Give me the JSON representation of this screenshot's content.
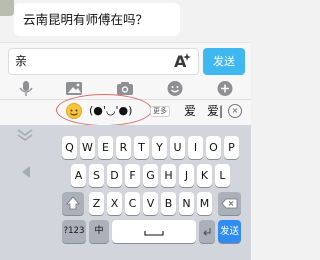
{
  "chat": {
    "message": "云南昆明有师傅在吗？"
  },
  "input": {
    "value": "亲",
    "font_label": "A",
    "send_label": "发送"
  },
  "tools": [
    "mic-icon",
    "image-icon",
    "camera-icon",
    "emoji-face-icon",
    "plus-icon"
  ],
  "candidates": {
    "emoji": "smiley-emoji",
    "kaomoji": "(●'◡'●)",
    "more_label": "更多",
    "word1": "爱",
    "word2": "爱|",
    "clear_icon": "clear-icon"
  },
  "keyboard": {
    "row1": [
      "Q",
      "W",
      "E",
      "R",
      "T",
      "Y",
      "U",
      "I",
      "O",
      "P"
    ],
    "row2": [
      "A",
      "S",
      "D",
      "F",
      "G",
      "H",
      "J",
      "K",
      "L"
    ],
    "row3": [
      "Z",
      "X",
      "C",
      "V",
      "B",
      "N",
      "M"
    ],
    "number_label": "?123",
    "lang_label": "中",
    "send_label": "发送"
  },
  "colors": {
    "accent": "#3fb8f1",
    "circle": "#d86b6b"
  }
}
